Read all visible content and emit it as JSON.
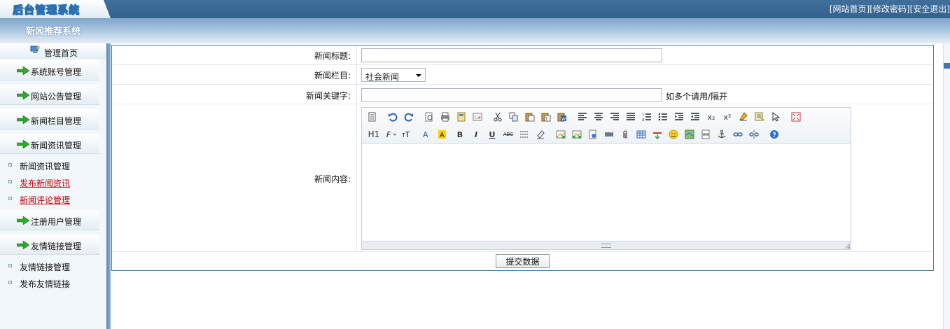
{
  "app": {
    "logo_title": "后台管理系统",
    "system_title": "新闻推荐系统"
  },
  "top_links": {
    "home": "[网站首页]",
    "change_password": "[修改密码]",
    "logout": "[安全退出]"
  },
  "sidebar": {
    "home_label": "管理首页",
    "groups": [
      {
        "label": "系统账号管理"
      },
      {
        "label": "网站公告管理"
      },
      {
        "label": "新闻栏目管理"
      },
      {
        "label": "新闻资讯管理",
        "items": [
          "新闻资讯管理",
          "发布新闻资讯",
          "新闻评论管理"
        ]
      },
      {
        "label": "注册用户管理"
      },
      {
        "label": "友情链接管理",
        "items": [
          "友情链接管理",
          "发布友情链接"
        ]
      }
    ]
  },
  "form": {
    "title_label": "新闻标题:",
    "title_value": "",
    "category_label": "新闻栏目:",
    "category_selected": "社会新闻",
    "keywords_label": "新闻关键字:",
    "keywords_value": "",
    "keywords_hint": "如多个请用/隔开",
    "content_label": "新闻内容:",
    "submit_label": "提交数据"
  },
  "editor_toolbar": {
    "row1": [
      "source-icon",
      "undo-icon",
      "redo-icon",
      "preview-icon",
      "print-icon",
      "template-icon",
      "paste-word-icon",
      "cut-icon",
      "copy-icon",
      "paste-icon",
      "paste-text-icon",
      "paste-word2-icon",
      "align-left-icon",
      "align-center-icon",
      "align-right-icon",
      "justify-icon",
      "ordered-list-icon",
      "unordered-list-icon",
      "indent-icon",
      "outdent-icon",
      "subscript-icon",
      "superscript-icon",
      "clear-format-icon",
      "select-all-icon",
      "select-icon",
      "fullscreen-icon"
    ],
    "row2": [
      "heading-icon",
      "font-family-icon",
      "font-size-icon",
      "font-color-icon",
      "highlight-color-icon",
      "bold-icon",
      "italic-icon",
      "underline-icon",
      "strikethrough-icon",
      "line-height-icon",
      "remove-format-icon",
      "image-icon",
      "multi-image-icon",
      "flash-icon",
      "media-icon",
      "attachment-icon",
      "table-icon",
      "hr-icon",
      "emoticon-icon",
      "map-icon",
      "pagebreak-icon",
      "anchor-icon",
      "link-icon",
      "unlink-icon",
      "help-icon"
    ],
    "heading_text": "H1",
    "bold_text": "B",
    "italic_text": "I",
    "underline_text": "U",
    "strike_text": "ABC",
    "subscript_text": "x₂",
    "superscript_text": "x²"
  },
  "colors": {
    "topbar": "#3f6f9c",
    "form_border": "#4b7a9e",
    "accent_red": "#c00000"
  }
}
